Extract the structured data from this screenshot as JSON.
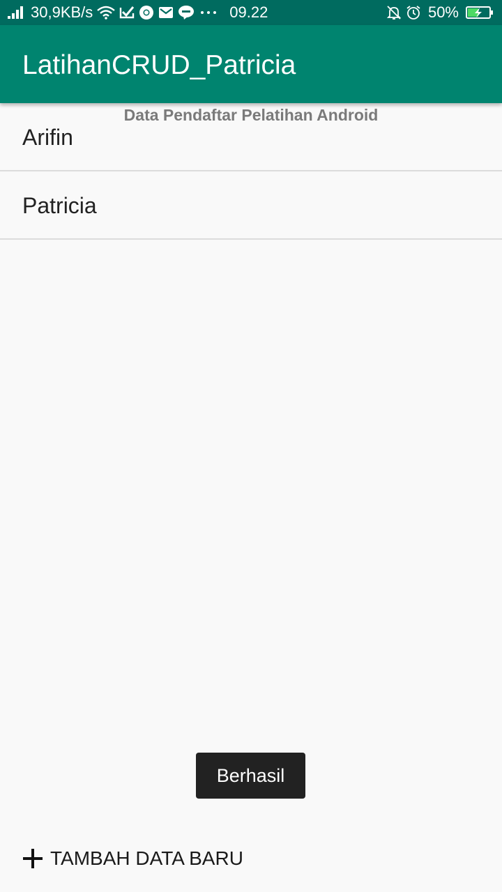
{
  "status_bar": {
    "network_speed": "30,9KB/s",
    "time": "09.22",
    "battery": "50%",
    "icons": [
      "signal-icon",
      "wifi-icon",
      "notification-check-icon",
      "chrome-icon",
      "gmail-icon",
      "line-icon",
      "more-icon",
      "silent-bell-icon",
      "alarm-icon",
      "battery-charging-icon"
    ],
    "battery_level": 0.5,
    "colors": {
      "background": "#006b5f",
      "battery_fill": "#4cd964"
    }
  },
  "app_bar": {
    "title": "LatihanCRUD_Patricia",
    "color": "#00846f"
  },
  "main": {
    "list_header": "Data Pendaftar Pelatihan Android",
    "items": [
      {
        "label": "Arifin"
      },
      {
        "label": "Patricia"
      }
    ]
  },
  "toast": {
    "text": "Berhasil"
  },
  "add_button": {
    "icon": "plus-icon",
    "label": "TAMBAH DATA BARU"
  }
}
